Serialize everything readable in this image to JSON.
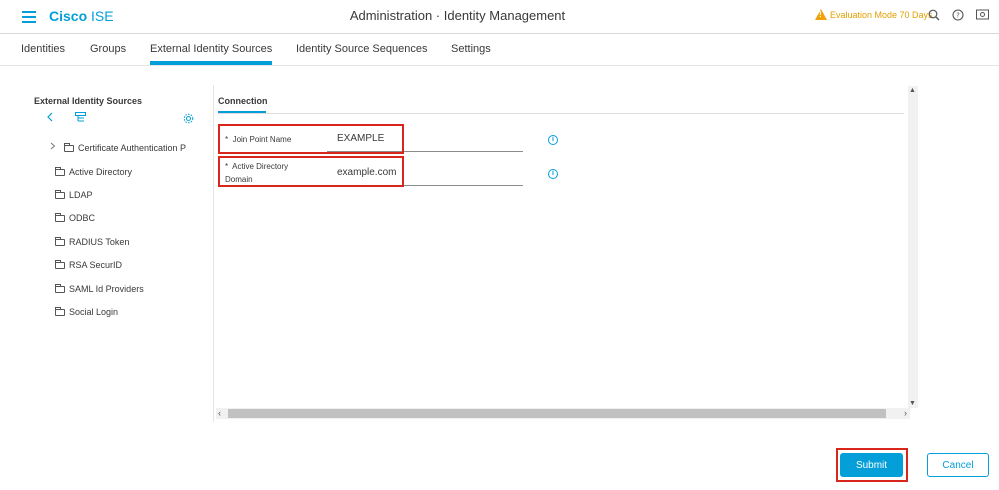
{
  "header": {
    "brand_bold": "Cisco",
    "brand_light": "ISE",
    "title": "Administration · Identity Management",
    "evaluation": "Evaluation Mode 70 Days",
    "icons": [
      "menu-icon",
      "warning-icon",
      "search-icon",
      "help-icon",
      "settings-icon"
    ]
  },
  "tabs": [
    {
      "label": "Identities"
    },
    {
      "label": "Groups"
    },
    {
      "label": "External Identity Sources",
      "active": true
    },
    {
      "label": "Identity Source Sequences"
    },
    {
      "label": "Settings"
    }
  ],
  "sidebar": {
    "title": "External Identity Sources",
    "items": [
      {
        "label": "Certificate Authentication P"
      },
      {
        "label": "Active Directory"
      },
      {
        "label": "LDAP"
      },
      {
        "label": "ODBC"
      },
      {
        "label": "RADIUS Token"
      },
      {
        "label": "RSA SecurID"
      },
      {
        "label": "SAML Id Providers"
      },
      {
        "label": "Social Login"
      }
    ]
  },
  "content": {
    "tab": "Connection",
    "fields": [
      {
        "label": "Join Point Name",
        "value": "EXAMPLE",
        "required": "*"
      },
      {
        "label_line1": "Active Directory",
        "label_line2": "Domain",
        "value": "example.com",
        "required": "*"
      }
    ]
  },
  "buttons": {
    "submit": "Submit",
    "cancel": "Cancel"
  },
  "colors": {
    "accent": "#049fd9",
    "highlight": "#d9261c",
    "warning": "#f0a20a"
  }
}
